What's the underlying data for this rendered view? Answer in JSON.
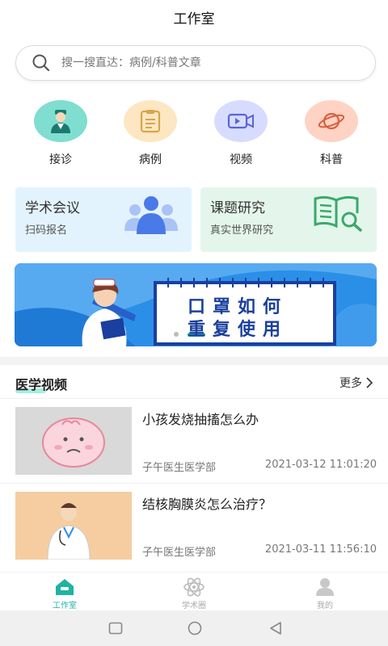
{
  "header": {
    "title": "工作室"
  },
  "search": {
    "placeholder": "搜一搜直达：病例/科普文章",
    "icon": "search-icon"
  },
  "quick_actions": [
    {
      "label": "接诊",
      "icon": "doctor-icon",
      "bg": "#7fded0"
    },
    {
      "label": "病例",
      "icon": "clipboard-icon",
      "bg": "#fde7c2"
    },
    {
      "label": "视频",
      "icon": "video-camera-icon",
      "bg": "#d7dcff"
    },
    {
      "label": "科普",
      "icon": "planet-icon",
      "bg": "#ffd3c4"
    }
  ],
  "cards": [
    {
      "title": "学术会议",
      "subtitle": "扫码报名",
      "bg": "#e3f3fe",
      "icon": "people-icon"
    },
    {
      "title": "课题研究",
      "subtitle": "真实世界研究",
      "bg": "#e4f6ec",
      "icon": "book-search-icon"
    }
  ],
  "banner": {
    "line1": "口罩如何",
    "line2": "重复使用"
  },
  "section": {
    "title": "医学视频",
    "more": "更多"
  },
  "videos": [
    {
      "title": "小孩发烧抽搐怎么办",
      "source": "子午医生医学部",
      "time": "2021-03-12 11:01:20"
    },
    {
      "title": "结核胸膜炎怎么治疗？",
      "source": "子午医生医学部",
      "time": "2021-03-11 11:56:10"
    }
  ],
  "tabs": [
    {
      "label": "工作室",
      "active": true
    },
    {
      "label": "学术圈",
      "active": false
    },
    {
      "label": "我的",
      "active": false
    }
  ],
  "colors": {
    "accent": "#20b3a4",
    "banner_blue": "#2b8fe8",
    "banner_text": "#1a3f9e"
  }
}
